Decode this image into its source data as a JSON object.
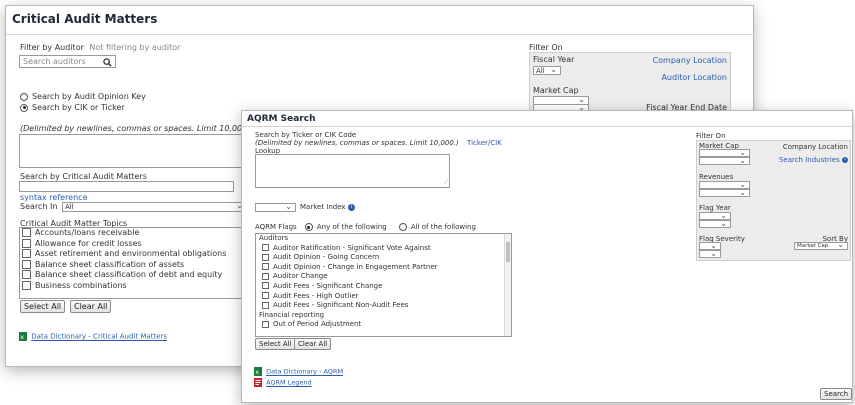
{
  "cam": {
    "title": "Critical Audit Matters",
    "filter_by_auditor_label": "Filter by Auditor",
    "filter_by_auditor_status": "Not filtering by auditor",
    "search_auditors_placeholder": "Search auditors",
    "radio_opinion_key": "Search by Audit Opinion Key",
    "radio_cik_ticker": "Search by CIK or Ticker",
    "delimited_note": "(Delimited by newlines, commas or spaces. Limit 10,000)",
    "search_by_cam_label": "Search by Critical Audit Matters",
    "syntax_reference": "syntax reference",
    "search_in_label": "Search In",
    "search_in_value": "All",
    "topics_label": "Critical Audit Matter Topics",
    "topics": [
      "Accounts/loans receivable",
      "Allowance for credit losses",
      "Asset retirement and environmental obligations",
      "Balance sheet classification of assets",
      "Balance sheet classification of debt and equity",
      "Business combinations"
    ],
    "select_all": "Select All",
    "clear_all": "Clear All",
    "data_dictionary": "Data Dictionary - Critical Audit Matters",
    "filter_on": "Filter On",
    "fiscal_year": "Fiscal Year",
    "fiscal_year_value": "All",
    "company_location": "Company Location",
    "auditor_location": "Auditor Location",
    "market_cap": "Market Cap",
    "fiscal_year_end_date": "Fiscal Year End Date"
  },
  "aqrm": {
    "title": "AQRM Search",
    "search_by_label": "Search by Ticker or CIK Code",
    "delimited_note": "(Delimited by newlines, commas or spaces. Limit 10,000.)",
    "ticker_cik_lookup_1": "Ticker/CIK",
    "ticker_cik_lookup_2": "Lookup",
    "market_index": "Market Index",
    "aqrm_flags": "AQRM Flags",
    "any_of_following": "Any of the following",
    "all_of_following": "All of the following",
    "group_auditors": "Auditors",
    "flags_auditors": [
      "Auditor Ratification - Significant Vote Against",
      "Audit Opinion - Going Concern",
      "Audit Opinion - Change in Engagement Partner",
      "Auditor Change",
      "Audit Fees - Significant Change",
      "Audit Fees - High Outlier",
      "Audit Fees - Significant Non-Audit Fees"
    ],
    "group_financial": "Financial reporting",
    "flags_financial": [
      "Out of Period Adjustment"
    ],
    "select_all": "Select All",
    "clear_all": "Clear All",
    "data_dictionary": "Data Dictionary - AQRM",
    "aqrm_legend": "AQRM Legend",
    "search_button": "Search",
    "filter_on": "Filter On",
    "market_cap": "Market Cap",
    "company_location": "Company Location",
    "search_industries": "Search Industries",
    "revenues": "Revenues",
    "flag_year": "Flag Year",
    "flag_severity": "Flag Severity",
    "sort_by": "Sort By",
    "sort_by_value": "Market Cap"
  }
}
